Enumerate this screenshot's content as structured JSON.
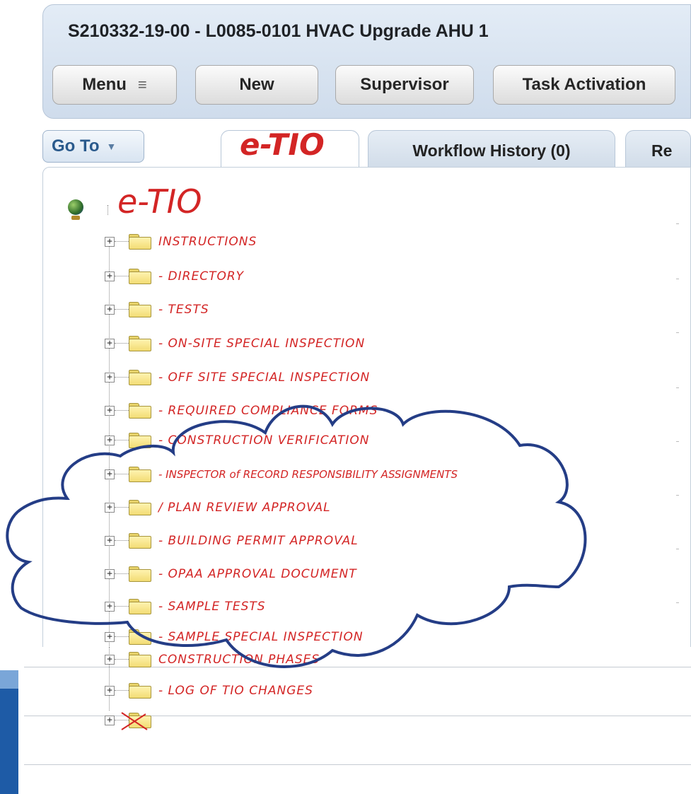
{
  "header": {
    "title": "S210332-19-00 - L0085-0101 HVAC Upgrade AHU 1",
    "buttons": {
      "menu": "Menu",
      "new": "New",
      "supervisor": "Supervisor",
      "task_activation": "Task Activation"
    }
  },
  "goto": {
    "label": "Go To"
  },
  "tabs": {
    "first_handwritten": "e-TIO",
    "workflow_history": "Workflow History (0)",
    "partial": "Re"
  },
  "tree": {
    "root_label": "e-TIO",
    "items": [
      "INSTRUCTIONS",
      "- DIRECTORY",
      "- TESTS",
      "- ON-SITE SPECIAL INSPECTION",
      "- OFF SITE SPECIAL INSPECTION",
      "- REQUIRED COMPLIANCE FORMS",
      "- CONSTRUCTION VERIFICATION",
      "- INSPECTOR of RECORD RESPONSIBILITY ASSIGNMENTS",
      "/ PLAN REVIEW APPROVAL",
      "- BUILDING PERMIT APPROVAL",
      "- OPAA APPROVAL DOCUMENT",
      "- SAMPLE TESTS",
      "- SAMPLE SPECIAL INSPECTION",
      "CONSTRUCTION PHASES",
      "- LOG OF TIO CHANGES",
      ""
    ]
  },
  "colors": {
    "annotation_red": "#d32525",
    "cloud_blue": "#243d86",
    "header_bg": "#d8e3f0",
    "accent_blue": "#1e5ba6"
  },
  "icons": {
    "menu": "hamburger-icon",
    "goto": "triangle-down-icon",
    "root": "globe-icon",
    "folder": "folder-icon",
    "expand": "plus-box-icon"
  }
}
